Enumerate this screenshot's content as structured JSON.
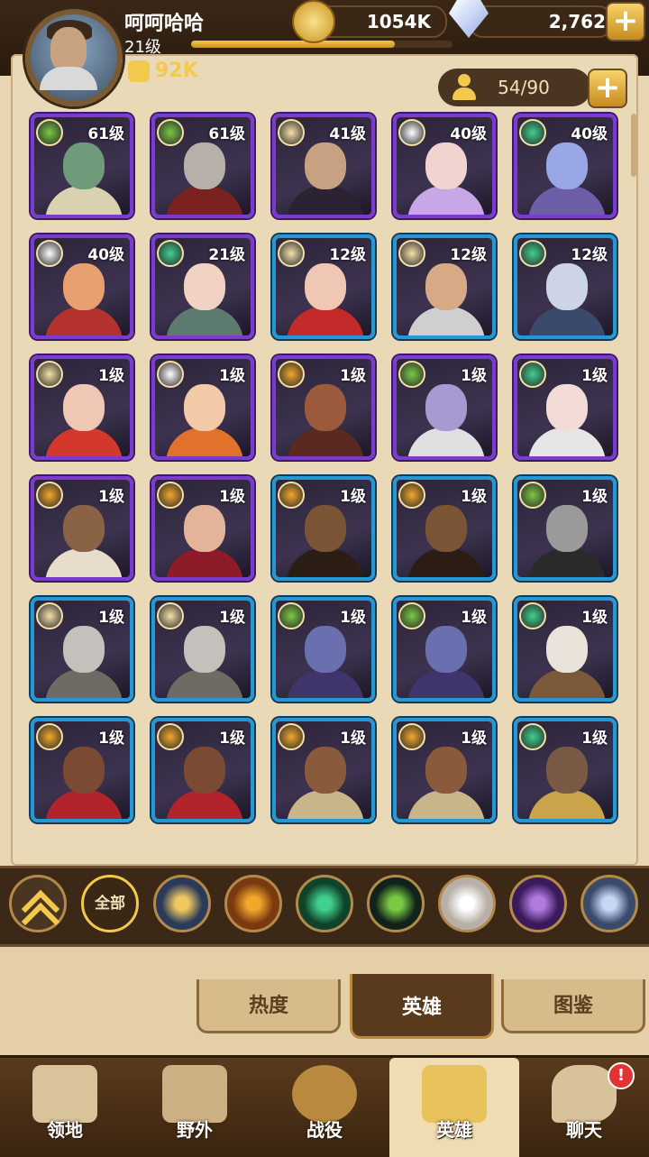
{
  "player": {
    "name": "呵呵哈哈",
    "level": "21级",
    "power": "92K",
    "xp_fraction": 0.78
  },
  "resources": {
    "gold": "1054K",
    "gems": "2,762",
    "plus": "+"
  },
  "roster": {
    "capacity": "54/90",
    "plus": "+"
  },
  "heroes": [
    {
      "level": "61级",
      "frame": "purple",
      "faction": "#7ac943",
      "skin": "#6f9b7a",
      "robe": "#d9d1b0"
    },
    {
      "level": "61级",
      "frame": "purple",
      "faction": "#7ac943",
      "skin": "#b7b0a8",
      "robe": "#7a2121"
    },
    {
      "level": "41级",
      "frame": "purple",
      "faction": "#f5e0a8",
      "skin": "#c8a182",
      "robe": "#2b2233"
    },
    {
      "level": "40级",
      "frame": "purple",
      "faction": "#ffffff",
      "skin": "#f1d4cf",
      "robe": "#c8a7e6"
    },
    {
      "level": "40级",
      "frame": "purple",
      "faction": "#3fcf8e",
      "skin": "#9aa7e6",
      "robe": "#6c5fa8"
    },
    {
      "level": "40级",
      "frame": "purple",
      "faction": "#ffffff",
      "skin": "#e7a06e",
      "robe": "#b4322e"
    },
    {
      "level": "21级",
      "frame": "purple",
      "faction": "#3fcf8e",
      "skin": "#f2d2c2",
      "robe": "#5c7a6e"
    },
    {
      "level": "12级",
      "frame": "blue",
      "faction": "#f5e0a8",
      "skin": "#f0c6b5",
      "robe": "#c42a2a"
    },
    {
      "level": "12级",
      "frame": "blue",
      "faction": "#f5e0a8",
      "skin": "#d7a985",
      "robe": "#cfcfcf"
    },
    {
      "level": "12级",
      "frame": "blue",
      "faction": "#3fcf8e",
      "skin": "#cdd4e6",
      "robe": "#3b4a6b"
    },
    {
      "level": "1级",
      "frame": "purple",
      "faction": "#f5e0a8",
      "skin": "#f0c6b5",
      "robe": "#d2382c"
    },
    {
      "level": "1级",
      "frame": "purple",
      "faction": "#ffffff",
      "skin": "#f3caa8",
      "robe": "#e0722b"
    },
    {
      "level": "1级",
      "frame": "purple",
      "faction": "#f2a72b",
      "skin": "#9c5a3c",
      "robe": "#5a2a20"
    },
    {
      "level": "1级",
      "frame": "purple",
      "faction": "#7ac943",
      "skin": "#a69ad0",
      "robe": "#e0e0e0"
    },
    {
      "level": "1级",
      "frame": "purple",
      "faction": "#3fcf8e",
      "skin": "#f3dcd5",
      "robe": "#e6e6e6"
    },
    {
      "level": "1级",
      "frame": "purple",
      "faction": "#f2a72b",
      "skin": "#8a6244",
      "robe": "#e8dccb"
    },
    {
      "level": "1级",
      "frame": "purple",
      "faction": "#f2a72b",
      "skin": "#e3b49a",
      "robe": "#8e1b2a"
    },
    {
      "level": "1级",
      "frame": "blue",
      "faction": "#f2a72b",
      "skin": "#7a5434",
      "robe": "#2b1d14"
    },
    {
      "level": "1级",
      "frame": "blue",
      "faction": "#f2a72b",
      "skin": "#7a5434",
      "robe": "#2b1d14"
    },
    {
      "level": "1级",
      "frame": "blue",
      "faction": "#7ac943",
      "skin": "#9a9a9a",
      "robe": "#2a2a2a"
    },
    {
      "level": "1级",
      "frame": "blue",
      "faction": "#f5e0a8",
      "skin": "#c4c0bb",
      "robe": "#6d6b63"
    },
    {
      "level": "1级",
      "frame": "blue",
      "faction": "#f5e0a8",
      "skin": "#c4c0bb",
      "robe": "#6d6b63"
    },
    {
      "level": "1级",
      "frame": "blue",
      "faction": "#7ac943",
      "skin": "#6a6fb0",
      "robe": "#3f356b"
    },
    {
      "level": "1级",
      "frame": "blue",
      "faction": "#7ac943",
      "skin": "#6a6fb0",
      "robe": "#3f356b"
    },
    {
      "level": "1级",
      "frame": "blue",
      "faction": "#3fcf8e",
      "skin": "#e9e3da",
      "robe": "#7a5a3a"
    },
    {
      "level": "1级",
      "frame": "blue",
      "faction": "#f2a72b",
      "skin": "#7a4a32",
      "robe": "#b2232b"
    },
    {
      "level": "1级",
      "frame": "blue",
      "faction": "#f2a72b",
      "skin": "#7a4a32",
      "robe": "#b2232b"
    },
    {
      "level": "1级",
      "frame": "blue",
      "faction": "#f2a72b",
      "skin": "#8a5a3c",
      "robe": "#c9b58a"
    },
    {
      "level": "1级",
      "frame": "blue",
      "faction": "#f2a72b",
      "skin": "#8a5a3c",
      "robe": "#c9b58a"
    },
    {
      "level": "1级",
      "frame": "blue",
      "faction": "#3fcf8e",
      "skin": "#7a5a44",
      "robe": "#c9a44a"
    }
  ],
  "filters": {
    "all_label": "全部",
    "factions": [
      {
        "name": "lightbearer-star",
        "color": "#f0c860",
        "bg": "#2a3a5a"
      },
      {
        "name": "mauler-sun",
        "color": "#f2a72b",
        "bg": "#7a3a10"
      },
      {
        "name": "wilder-leaf",
        "color": "#3fcf8e",
        "bg": "#10442a"
      },
      {
        "name": "graveborn-eye",
        "color": "#7ac943",
        "bg": "#10221a"
      },
      {
        "name": "celestial-star",
        "color": "#ffffff",
        "bg": "#b8b0a8"
      },
      {
        "name": "hypogean-crystal",
        "color": "#b07ae0",
        "bg": "#3a1a5a"
      },
      {
        "name": "dimensional-ring",
        "color": "#c8d6f5",
        "bg": "#3a4a6a"
      }
    ]
  },
  "subtabs": {
    "hot": "热度",
    "heroes": "英雄",
    "codex": "图鉴"
  },
  "nav": {
    "ranhaven": "领地",
    "darkforest": "野外",
    "campaign": "战役",
    "heroes": "英雄",
    "chat": "聊天",
    "chat_badge": "!"
  }
}
